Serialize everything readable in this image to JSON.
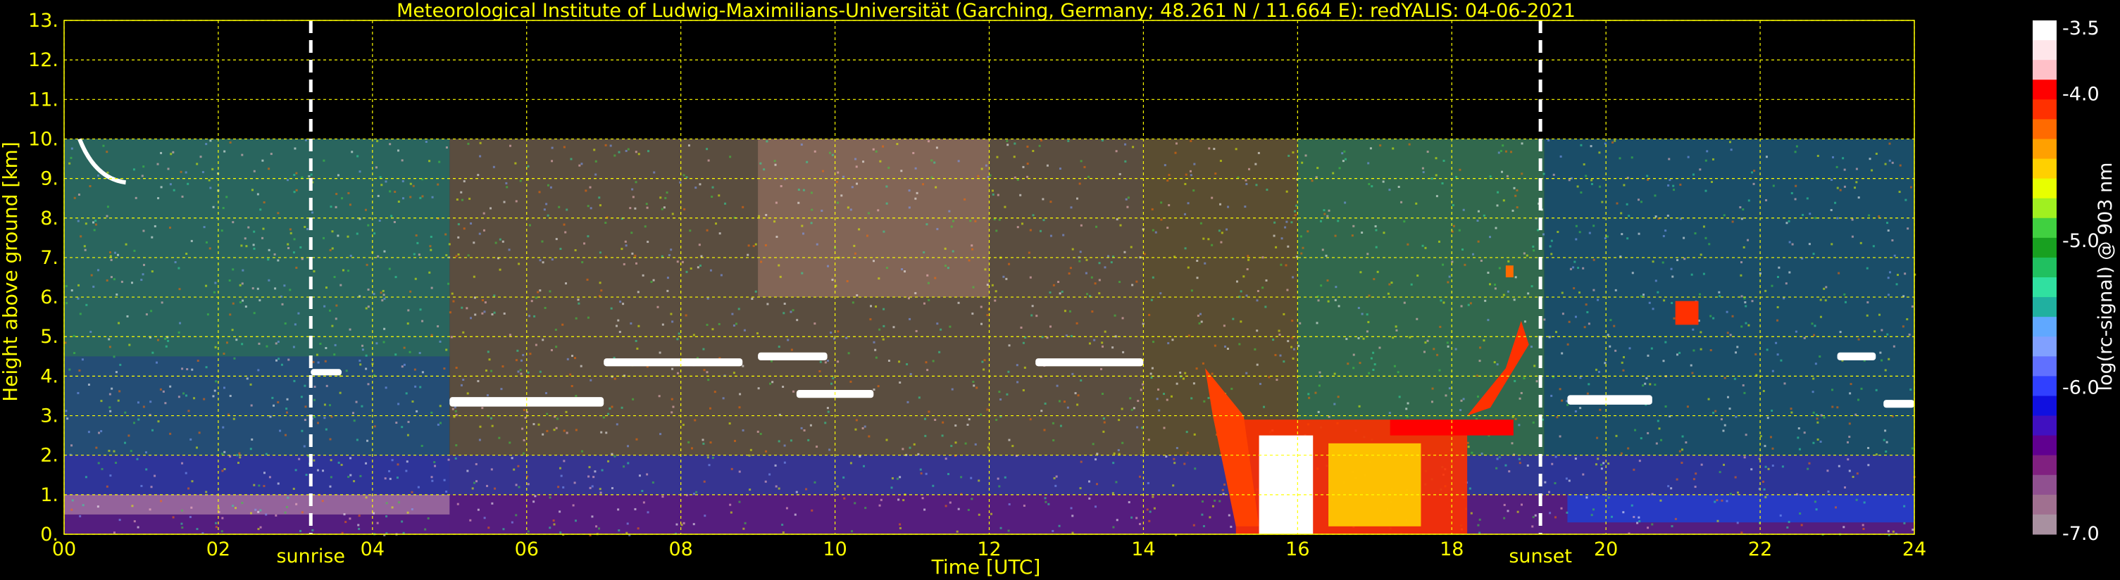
{
  "chart_data": {
    "type": "heatmap",
    "title": "Meteorological Institute of Ludwig-Maximilians-Universität (Garching, Germany; 48.261 N / 11.664 E):    redYALIS: 04-06-2021",
    "xlabel": "Time [UTC]",
    "ylabel": "Height above ground [km]",
    "xlim": [
      0,
      24
    ],
    "ylim": [
      0,
      13
    ],
    "x_ticks": [
      "00",
      "02",
      "04",
      "06",
      "08",
      "10",
      "12",
      "14",
      "16",
      "18",
      "20",
      "22",
      "24"
    ],
    "y_ticks": [
      "0.",
      "1.",
      "2.",
      "3.",
      "4.",
      "5.",
      "6.",
      "7.",
      "8.",
      "9.",
      "10.",
      "11.",
      "12.",
      "13."
    ],
    "grid": true,
    "data_top_km": 10,
    "markers": [
      {
        "label": "sunrise",
        "x": 3.2
      },
      {
        "label": "sunset",
        "x": 19.15
      }
    ],
    "colorbar": {
      "label": "log(rc-signal) @ 903 nm",
      "range": [
        -7.0,
        -3.5
      ],
      "ticks": [
        "-3.5",
        "-4.0",
        "-5.0",
        "-6.0",
        "-7.0"
      ],
      "tick_values": [
        -3.5,
        -4.0,
        -5.0,
        -6.0,
        -7.0
      ],
      "colors": [
        "#ffffff",
        "#ffe6ea",
        "#ffc0c8",
        "#ff0000",
        "#ff3000",
        "#ff6a00",
        "#ffa000",
        "#ffd000",
        "#e8ff00",
        "#a0f020",
        "#40d040",
        "#18a020",
        "#20c060",
        "#30e0a0",
        "#20b0a0",
        "#60a8ff",
        "#80a0ff",
        "#6070ff",
        "#3040ff",
        "#1010e0",
        "#4010c0",
        "#600090",
        "#802080",
        "#905090",
        "#a07090",
        "#a890a0"
      ]
    }
  }
}
